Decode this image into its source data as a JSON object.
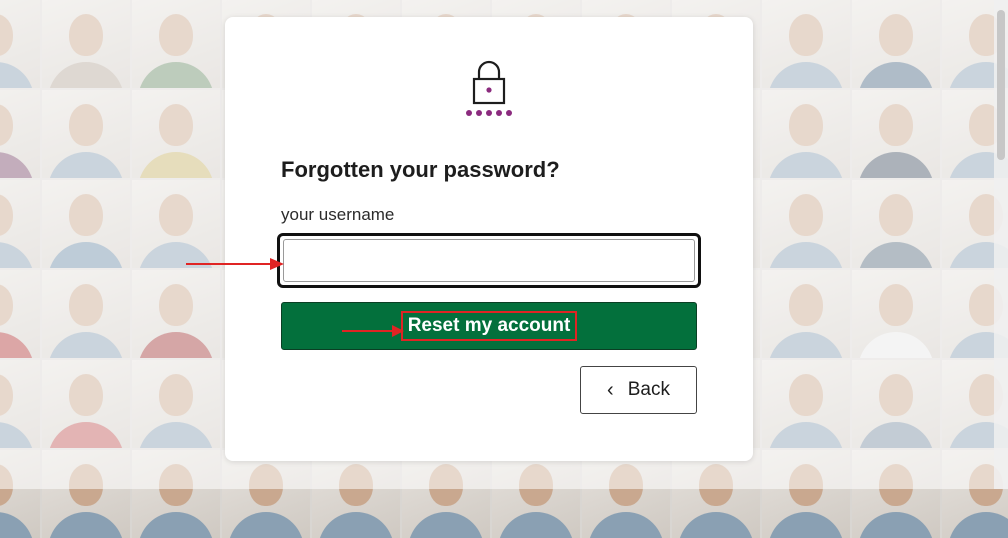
{
  "form": {
    "title": "Forgotten your password?",
    "username_label": "your username",
    "username_value": "",
    "reset_button_label": "Reset my account",
    "back_button_label": "Back",
    "back_icon": "chevron-left-icon",
    "lock_icon": "lock-icon"
  },
  "colors": {
    "primary_button": "#03703c",
    "lock_dots": "#8b2b7e",
    "annotation": "#e02424"
  }
}
